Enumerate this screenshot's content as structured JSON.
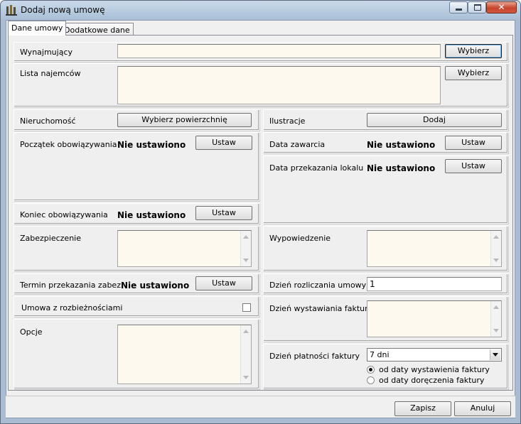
{
  "window": {
    "title": "Dodaj nową umowę",
    "controls": {
      "minimize": "minimize-icon",
      "maximize": "maximize-icon",
      "close": "close-icon",
      "close_glyph": "✕"
    }
  },
  "tabs": [
    {
      "label": "Dane umowy",
      "active": true
    },
    {
      "label": "Dodatkowe dane",
      "active": false
    }
  ],
  "fields": {
    "wynajmujacy": {
      "label": "Wynajmujący",
      "value": "",
      "button": "Wybierz"
    },
    "najemcy": {
      "label": "Lista najemców",
      "value": "",
      "button": "Wybierz"
    },
    "nieruchomosc": {
      "label": "Nieruchomość",
      "button": "Wybierz powierzchnię"
    },
    "ilustracje": {
      "label": "Ilustracje",
      "button": "Dodaj"
    },
    "poczatek": {
      "label": "Początek obowiązywania",
      "value": "Nie ustawiono",
      "button": "Ustaw"
    },
    "data_zawarcia": {
      "label": "Data zawarcia",
      "value": "Nie ustawiono",
      "button": "Ustaw"
    },
    "data_przekazania": {
      "label": "Data przekazania lokalu",
      "value": "Nie ustawiono",
      "button": "Ustaw"
    },
    "koniec": {
      "label": "Koniec obowiązywania",
      "value": "Nie ustawiono",
      "button": "Ustaw"
    },
    "zabezpieczenie": {
      "label": "Zabezpieczenie",
      "value": ""
    },
    "wypowiedzenie": {
      "label": "Wypowiedzenie",
      "value": ""
    },
    "termin_zabez": {
      "label": "Termin przekazania zabez.",
      "value": "Nie ustawiono",
      "button": "Ustaw"
    },
    "dzien_rozliczania": {
      "label": "Dzień rozliczania umowy",
      "value": "1"
    },
    "rozbieznosci": {
      "label": "Umowa z rozbieżnościami",
      "checked": false
    },
    "dzien_wystawiania": {
      "label": "Dzień wystawiania faktury",
      "value": ""
    },
    "opcje": {
      "label": "Opcje",
      "value": ""
    },
    "dzien_platnosci": {
      "label": "Dzień płatności faktury",
      "selected": "7 dni",
      "options": [
        {
          "label": "od daty wystawienia faktury",
          "checked": true
        },
        {
          "label": "od daty doręczenia faktury",
          "checked": false
        }
      ]
    }
  },
  "footer": {
    "save": "Zapisz",
    "cancel": "Anuluj"
  }
}
